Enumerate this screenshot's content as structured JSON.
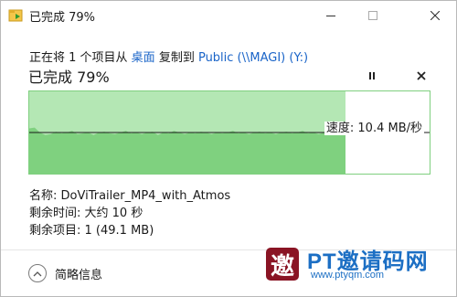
{
  "window": {
    "title": "已完成 79%",
    "controls": {
      "minimize_icon": "minimize-icon",
      "maximize_icon": "maximize-icon",
      "close_icon": "close-icon"
    }
  },
  "copy_line": {
    "prefix": "正在将 1 个项目从 ",
    "source": "桌面",
    "middle": " 复制到 ",
    "destination": "Public (\\\\MAGI) (Y:)"
  },
  "progress": {
    "title": "已完成 79%",
    "percent": 79,
    "speed_label": "速度: 10.4 MB/秒"
  },
  "graph": {
    "speed_samples": [
      0.55,
      0.56,
      0.5,
      0.47,
      0.48,
      0.51,
      0.49,
      0.5,
      0.52,
      0.48,
      0.49,
      0.5,
      0.47,
      0.5,
      0.51,
      0.49,
      0.48,
      0.5,
      0.52,
      0.49,
      0.5,
      0.48,
      0.5,
      0.51,
      0.47,
      0.5,
      0.49,
      0.52,
      0.5,
      0.48,
      0.5,
      0.49,
      0.51,
      0.5,
      0.48,
      0.5,
      0.49,
      0.5,
      0.52,
      0.49,
      0.5,
      0.48,
      0.5,
      0.51,
      0.49,
      0.5,
      0.48,
      0.5,
      0.51,
      0.49,
      0.5,
      0.52,
      0.49,
      0.5,
      0.48,
      0.5,
      0.51,
      0.49,
      0.5,
      0.5
    ],
    "current_speed_level": 0.5,
    "colors": {
      "fill": "#7fd17f",
      "done_bg": "#b4e7b4",
      "line": "#1a1a1a",
      "border": "#7fcf7f"
    }
  },
  "details": {
    "name_label": "名称: ",
    "name_value": "DoViTrailer_MP4_with_Atmos",
    "time_label": "剩余时间: ",
    "time_value": "大约 10 秒",
    "items_label": "剩余项目: ",
    "items_value": "1 (49.1 MB)"
  },
  "footer": {
    "toggle_label": "简略信息",
    "toggle_icon": "chevron-up-icon"
  },
  "watermark": {
    "logo_char": "邀",
    "title": "PT邀请码网",
    "url": "www.ptyqm.com"
  },
  "colors": {
    "accent": "#1a64c8",
    "watermark": "#1c6fc4",
    "logo_bg": "#8a1424"
  }
}
